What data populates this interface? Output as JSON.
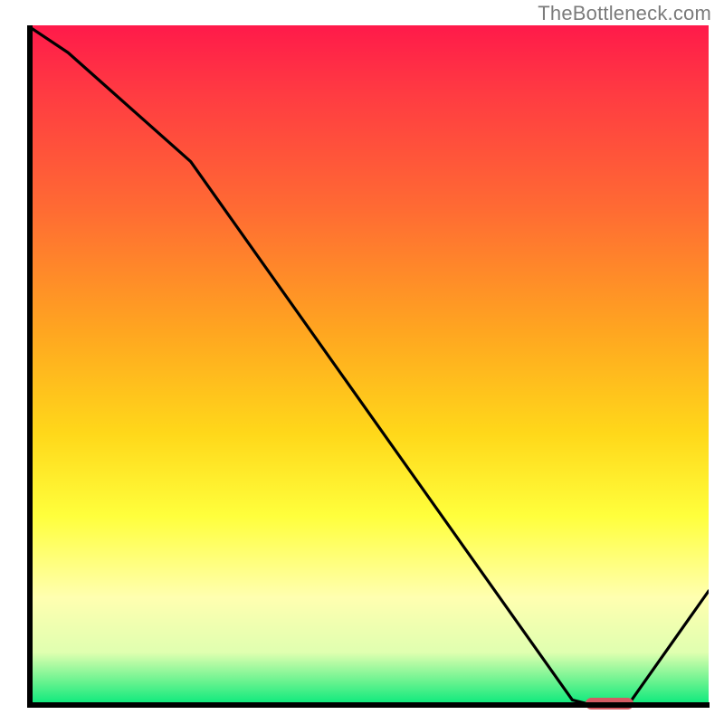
{
  "attribution": "TheBottleneck.com",
  "chart_data": {
    "type": "line",
    "title": "",
    "xlabel": "",
    "ylabel": "",
    "xlim": [
      0,
      100
    ],
    "ylim": [
      0,
      100
    ],
    "grid": false,
    "x": [
      0,
      6,
      24,
      80,
      84,
      88,
      100
    ],
    "values": [
      100,
      96,
      80,
      1,
      0,
      0,
      17
    ],
    "optimal_marker": {
      "x_start": 82,
      "x_end": 89,
      "y": 0
    },
    "background": "vertical gradient red→orange→yellow→green (bottleneck severity, green=optimal)"
  },
  "colors": {
    "curve": "#000000",
    "marker": "#d35b63",
    "axis": "#000000",
    "attribution": "#7b7b7b"
  }
}
